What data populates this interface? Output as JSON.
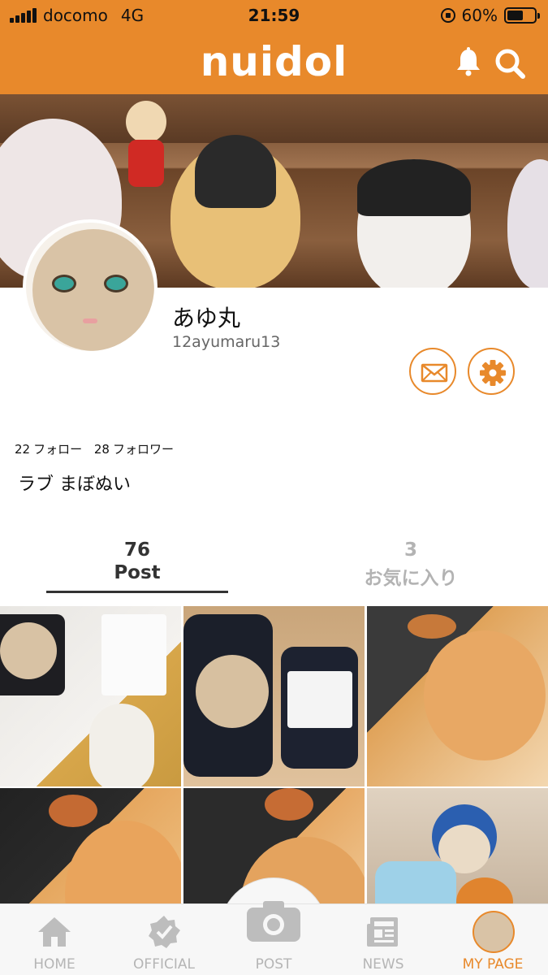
{
  "status_bar": {
    "carrier": "docomo",
    "network": "4G",
    "time": "21:59",
    "battery_percent": "60%",
    "battery_level": 0.6
  },
  "header": {
    "logo": "nuidol",
    "accent_color": "#e8892b",
    "icons": [
      "bell-icon",
      "search-icon"
    ]
  },
  "profile": {
    "display_name": "あゆ丸",
    "user_id": "12ayumaru13",
    "following_count": "22",
    "following_label": "フォロー",
    "followers_count": "28",
    "followers_label": "フォロワー",
    "bio": "ラブ まぼぬい"
  },
  "tabs": [
    {
      "count": "76",
      "label": "Post",
      "active": true
    },
    {
      "count": "3",
      "label": "お気に入り",
      "active": false
    }
  ],
  "bottom_nav": [
    {
      "label": "HOME",
      "icon": "home-icon"
    },
    {
      "label": "OFFICIAL",
      "icon": "badge-check-icon"
    },
    {
      "label": "POST",
      "icon": "camera-icon"
    },
    {
      "label": "NEWS",
      "icon": "newspaper-icon"
    },
    {
      "label": "MY PAGE",
      "icon": "avatar",
      "active": true
    }
  ]
}
